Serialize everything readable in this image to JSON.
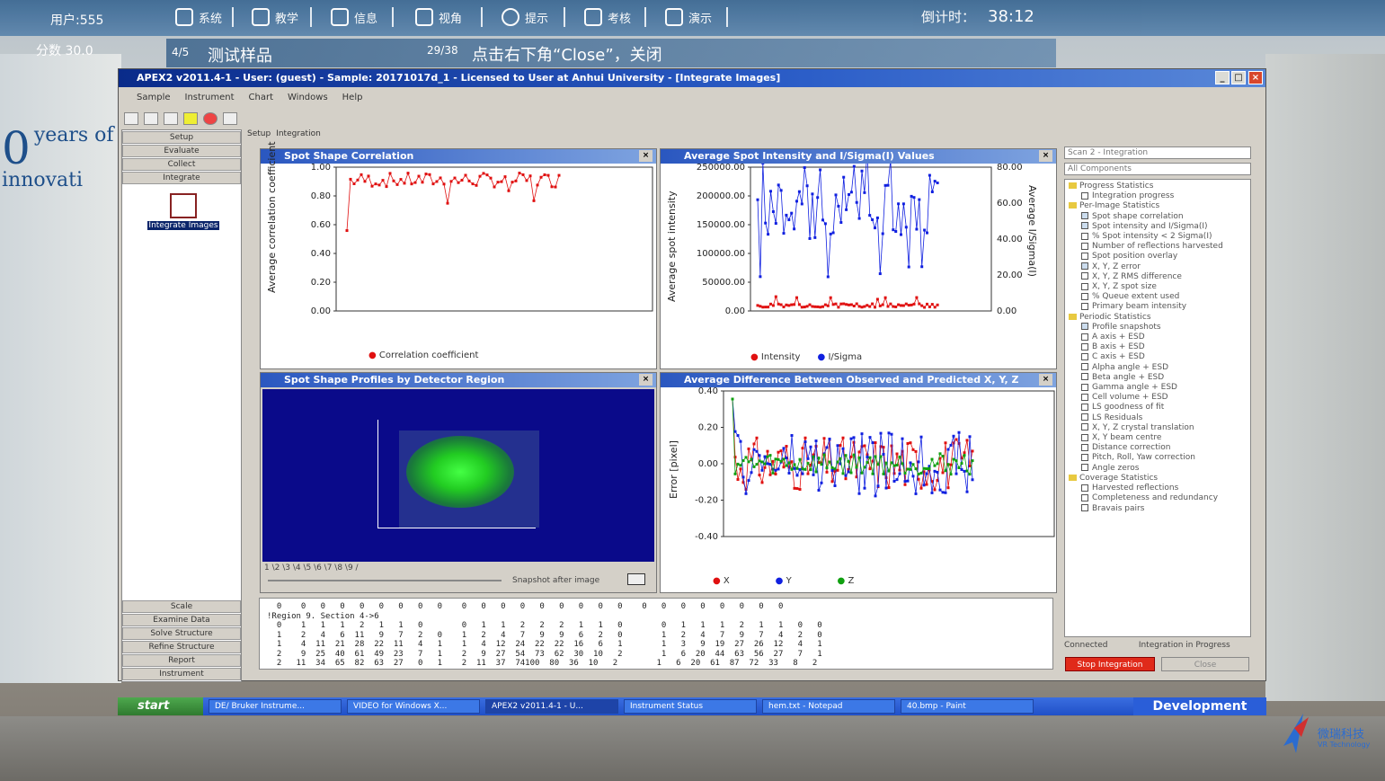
{
  "game": {
    "user": "用户:555",
    "score": "分数   30.0",
    "nav": [
      "系统",
      "教学",
      "信息",
      "视角",
      "提示",
      "考核",
      "演示"
    ],
    "timer_label": "倒计时：",
    "timer_value": "38:12",
    "step": "4/5",
    "sample_name": "测试样品",
    "progress": "29/38",
    "instruction": "点击右下角“Close”，关闭"
  },
  "background": {
    "text_big": "0",
    "text_line1": "years of",
    "text_line2": "innovati"
  },
  "window": {
    "title": "APEX2 v2011.4-1 - User: (guest) - Sample: 20171017d_1 - Licensed to User at Anhui University - [Integrate Images]",
    "menu": [
      "Sample",
      "Instrument",
      "Chart",
      "Windows",
      "Help"
    ],
    "nav_top": [
      "Setup",
      "Evaluate",
      "Collect",
      "Integrate"
    ],
    "nav_bottom": [
      "Scale",
      "Examine Data",
      "Solve Structure",
      "Refine Structure",
      "Report",
      "Instrument"
    ],
    "icon_label": "Integrate Images",
    "tabs": [
      "Setup",
      "Integration"
    ]
  },
  "panels": {
    "p1": {
      "title": "Spot Shape Correlation",
      "ylabel": "Average correlation coefficient",
      "yticks": [
        "1.00",
        "0.80",
        "0.60",
        "0.40",
        "0.20",
        "0.00"
      ],
      "legend": "Correlation coefficient"
    },
    "p2": {
      "title": "Average Spot Intensity and I/Sigma(I) Values",
      "ylabel": "Average spot intensity",
      "ylabel2": "Average I/Sigma(I)",
      "yticks": [
        "250000.00",
        "200000.00",
        "150000.00",
        "100000.00",
        "50000.00",
        "0.00"
      ],
      "yticks2": [
        "80.00",
        "60.00",
        "40.00",
        "20.00",
        "0.00"
      ],
      "legend1": "Intensity",
      "legend2": "I/Sigma"
    },
    "p3": {
      "title": "Spot Shape Profiles by Detector Region",
      "snapshot": "Snapshot after image"
    },
    "p4": {
      "title": "Average Difference Between Observed and Predicted X, Y, Z",
      "ylabel": "Error [pixel]",
      "yticks": [
        "0.40",
        "0.20",
        "0.00",
        "-0.20",
        "-0.40"
      ],
      "legend": [
        "X",
        "Y",
        "Z"
      ]
    }
  },
  "right": {
    "select1": "Scan 2 - Integration",
    "select2": "All Components",
    "tree": [
      {
        "t": "fold",
        "l": "Progress Statistics"
      },
      {
        "t": "cb",
        "l": "Integration progress"
      },
      {
        "t": "fold",
        "l": "Per-Image Statistics"
      },
      {
        "t": "cbx",
        "l": "Spot shape correlation"
      },
      {
        "t": "cbx",
        "l": "Spot intensity and I/Sigma(I)"
      },
      {
        "t": "cb",
        "l": "% Spot intensity < 2 Sigma(I)"
      },
      {
        "t": "cb",
        "l": "Number of reflections harvested"
      },
      {
        "t": "cb",
        "l": "Spot position overlay"
      },
      {
        "t": "cbx",
        "l": "X, Y, Z error"
      },
      {
        "t": "cb",
        "l": "X, Y, Z RMS difference"
      },
      {
        "t": "cb",
        "l": "X, Y, Z spot size"
      },
      {
        "t": "cb",
        "l": "% Queue extent used"
      },
      {
        "t": "cb",
        "l": "Primary beam intensity"
      },
      {
        "t": "fold",
        "l": "Periodic Statistics"
      },
      {
        "t": "cbx",
        "l": "Profile snapshots"
      },
      {
        "t": "cb",
        "l": "A axis + ESD"
      },
      {
        "t": "cb",
        "l": "B axis + ESD"
      },
      {
        "t": "cb",
        "l": "C axis + ESD"
      },
      {
        "t": "cb",
        "l": "Alpha angle + ESD"
      },
      {
        "t": "cb",
        "l": "Beta angle + ESD"
      },
      {
        "t": "cb",
        "l": "Gamma angle + ESD"
      },
      {
        "t": "cb",
        "l": "Cell volume + ESD"
      },
      {
        "t": "cb",
        "l": "LS goodness of fit"
      },
      {
        "t": "cb",
        "l": "LS Residuals"
      },
      {
        "t": "cb",
        "l": "X, Y, Z crystal translation"
      },
      {
        "t": "cb",
        "l": "X, Y beam centre"
      },
      {
        "t": "cb",
        "l": "Distance correction"
      },
      {
        "t": "cb",
        "l": "Pitch, Roll, Yaw correction"
      },
      {
        "t": "cb",
        "l": "Angle zeros"
      },
      {
        "t": "fold",
        "l": "Coverage Statistics"
      },
      {
        "t": "cb",
        "l": "Harvested reflections"
      },
      {
        "t": "cb",
        "l": "Completeness and redundancy"
      },
      {
        "t": "cb",
        "l": "Bravais pairs"
      }
    ],
    "status_connected": "Connected",
    "status_progress": "Integration in Progress",
    "stop_label": "Stop Integration",
    "close_label": "Close"
  },
  "console": "  0    0   0   0   0   0   0   0   0    0   0   0   0   0   0   0   0   0    0   0   0   0   0   0   0   0\n!Region 9. Section 4->6\n  0    1   1   1   2   1   1   0        0   1   1   2   2   2   1   1   0        0   1   1   1   2   1   1   0   0\n  1    2   4   6  11   9   7   2   0    1   2   4   7   9   9   6   2   0        1   2   4   7   9   7   4   2   0\n  1    4  11  21  28  22  11   4   1    1   4  12  24  22  22  16   6   1        1   3   9  19  27  26  12   4   1\n  2    9  25  40  61  49  23   7   1    2   9  27  54  73  62  30  10   2        1   6  20  44  63  56  27   7   1\n  2   11  34  65  82  63  27   0   1    2  11  37  74100  80  36  10   2        1   6  20  61  87  72  33   8   2",
  "taskbar": {
    "start": "start",
    "tasks": [
      "DE/ Bruker Instrume...",
      "VIDEO for Windows X...",
      "APEX2 v2011.4-1 - U...",
      "Instrument Status",
      "hem.txt - Notepad",
      "40.bmp - Paint"
    ],
    "dev": "Development"
  },
  "logo": {
    "name": "微瑞科技",
    "sub": "VR Technology"
  },
  "colors": {
    "red": "#e01010",
    "blue": "#1020e0",
    "green": "#10a010",
    "panel_head": "#2a57c0",
    "profile_bg": "#0a0a8a"
  }
}
